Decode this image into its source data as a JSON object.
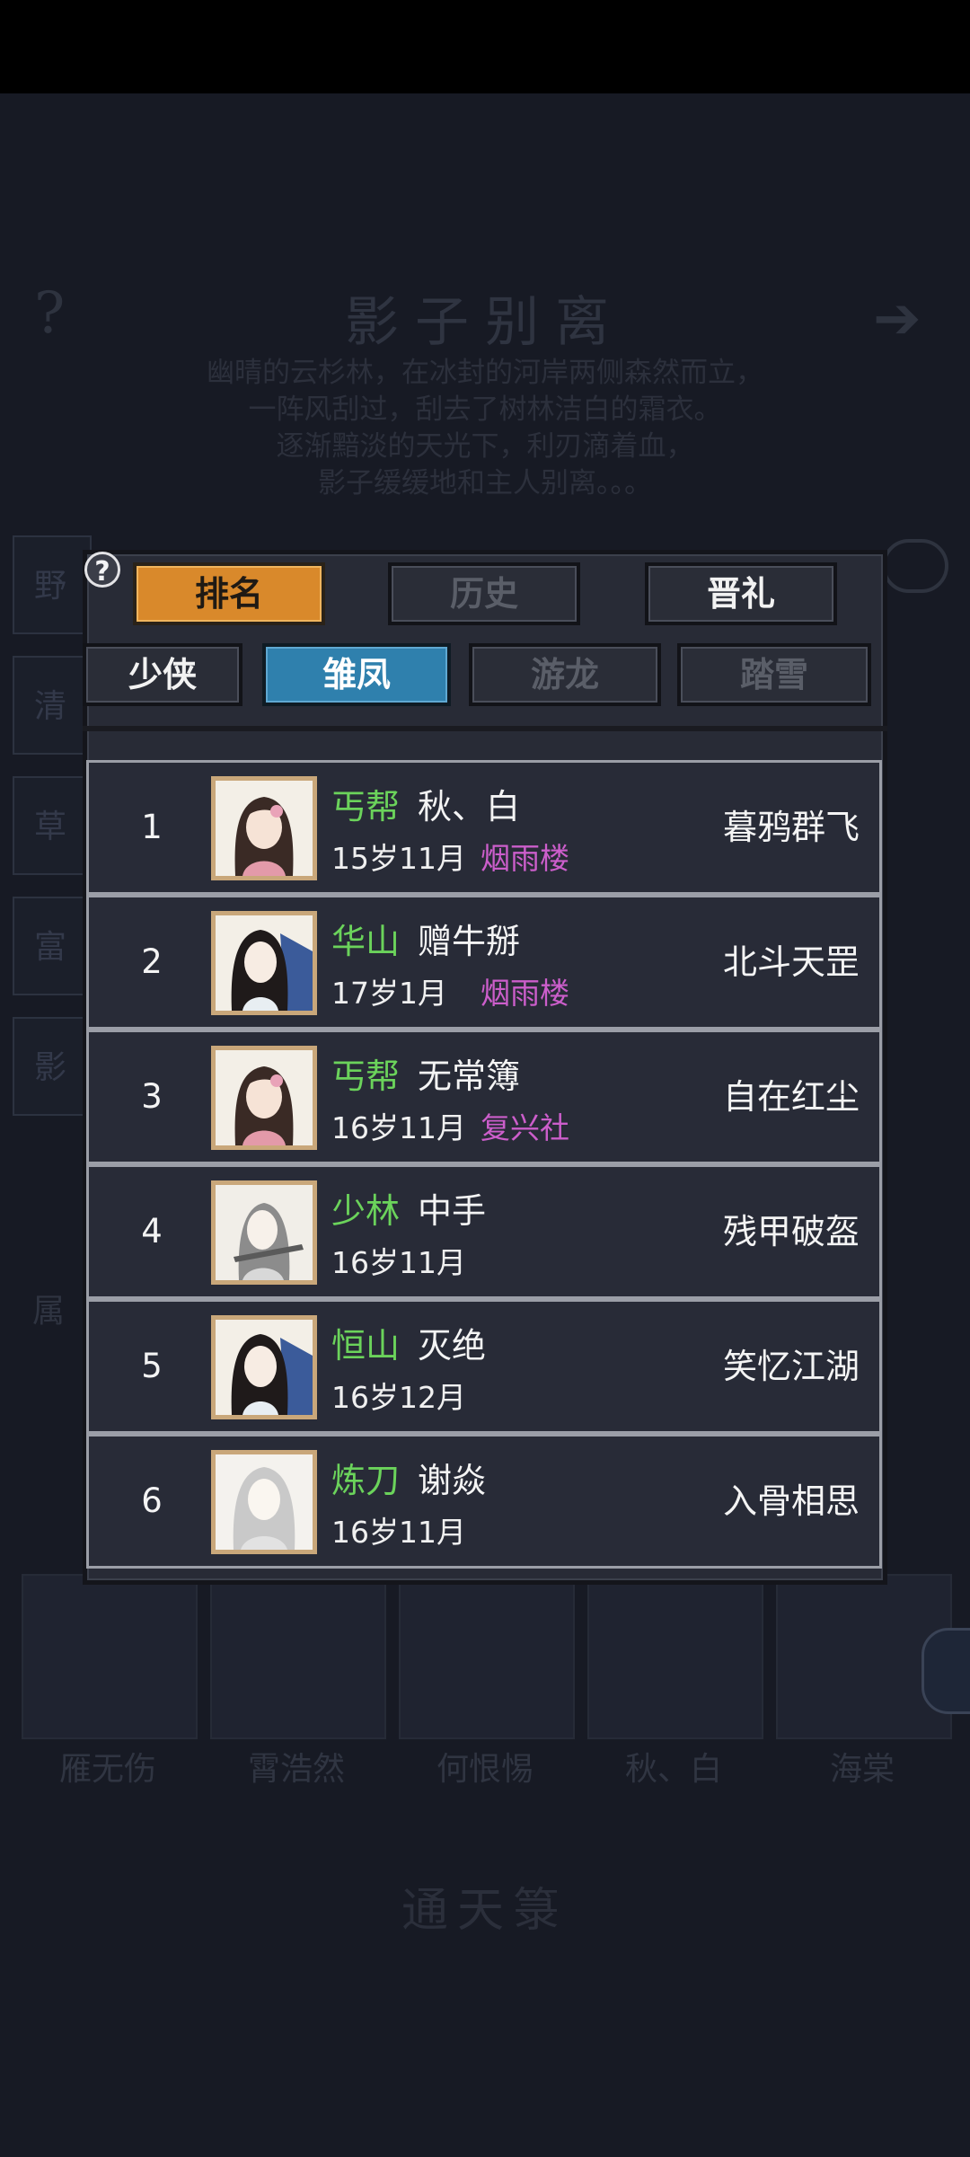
{
  "background": {
    "title": "影子别离",
    "poem": [
      "幽晴的云杉林，在冰封的河岸两侧森然而立，",
      "一阵风刮过，刮去了树林洁白的霜衣。",
      "逐渐黯淡的天光下，利刃滴着血，",
      "影子缓缓地和主人别离。。。"
    ],
    "help_glyph": "?",
    "arrow_glyph": "➔",
    "side_tabs": [
      "野",
      "清",
      "草",
      "富",
      "影"
    ],
    "attr_label": "属",
    "cards": [
      "雁无伤",
      "霄浩然",
      "何恨惕",
      "秋、白",
      "海棠"
    ],
    "bottom_title": "通天箓"
  },
  "dialog": {
    "help_glyph": "?",
    "top_tabs": [
      "排名",
      "历史",
      "晋礼"
    ],
    "sub_tabs": [
      "少侠",
      "雏凤",
      "游龙",
      "踏雪"
    ],
    "active_top_tab": "排名",
    "active_sub_tab": "雏凤"
  },
  "ranking": [
    {
      "rank": "1",
      "sect": "丐帮",
      "name": "秋、白",
      "age": "15岁11月",
      "guild": "烟雨楼",
      "title": "暮鸦群飞",
      "avatar": "female-flower-portrait"
    },
    {
      "rank": "2",
      "sect": "华山",
      "name": "赠牛掰",
      "age": "17岁1月",
      "guild": "烟雨楼",
      "title": "北斗天罡",
      "avatar": "female-fan-portrait"
    },
    {
      "rank": "3",
      "sect": "丐帮",
      "name": "无常簿",
      "age": "16岁11月",
      "guild": "复兴社",
      "title": "自在红尘",
      "avatar": "female-flower-portrait"
    },
    {
      "rank": "4",
      "sect": "少林",
      "name": "中手",
      "age": "16岁11月",
      "guild": "",
      "title": "残甲破盔",
      "avatar": "male-swordsman-portrait"
    },
    {
      "rank": "5",
      "sect": "恒山",
      "name": "灭绝",
      "age": "16岁12月",
      "guild": "",
      "title": "笑忆江湖",
      "avatar": "female-fan-portrait"
    },
    {
      "rank": "6",
      "sect": "炼刀",
      "name": "谢焱",
      "age": "16岁11月",
      "guild": "",
      "title": "入骨相思",
      "avatar": "male-white-hair-portrait"
    }
  ],
  "colors": {
    "sect_green": "#6bd35b",
    "guild_purple": "#cc5ecb",
    "active_tab_orange": "#d9892b",
    "active_tab_blue": "#2f80ad"
  }
}
